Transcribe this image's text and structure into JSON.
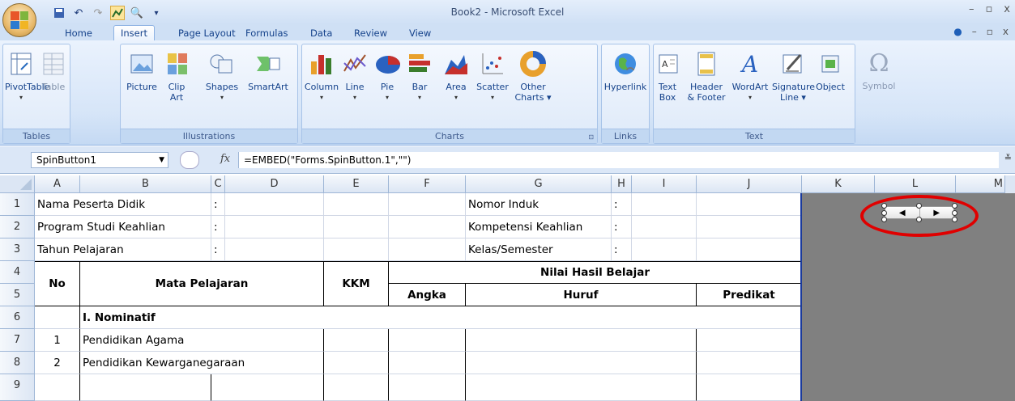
{
  "window": {
    "title": "Book2 - Microsoft Excel"
  },
  "qat": {
    "save_icon": "save-icon",
    "undo_icon": "undo-icon",
    "redo_icon": "redo-icon",
    "chart_icon": "chart-icon",
    "customize_icon": "customize-icon"
  },
  "tabs": [
    "Home",
    "Insert",
    "Page Layout",
    "Formulas",
    "Data",
    "Review",
    "View"
  ],
  "active_tab": "Insert",
  "ribbon": {
    "groups": {
      "tables": "Tables",
      "illustrations": "Illustrations",
      "charts": "Charts",
      "links": "Links",
      "text": "Text"
    },
    "buttons": {
      "pivottable": "PivotTable",
      "table": "Table",
      "picture": "Picture",
      "clipart_1": "Clip",
      "clipart_2": "Art",
      "shapes": "Shapes",
      "smartart": "SmartArt",
      "column": "Column",
      "line": "Line",
      "pie": "Pie",
      "bar": "Bar",
      "area": "Area",
      "scatter": "Scatter",
      "other_1": "Other",
      "other_2": "Charts ▾",
      "hyperlink": "Hyperlink",
      "textbox_1": "Text",
      "textbox_2": "Box",
      "header_1": "Header",
      "header_2": "& Footer",
      "wordart": "WordArt",
      "signature_1": "Signature",
      "signature_2": "Line ▾",
      "object": "Object",
      "symbol": "Symbol"
    }
  },
  "formula_bar": {
    "name_box": "SpinButton1",
    "fx": "fx",
    "formula": "=EMBED(\"Forms.SpinButton.1\",\"\")"
  },
  "columns": [
    "A",
    "B",
    "C",
    "D",
    "E",
    "F",
    "G",
    "H",
    "I",
    "J",
    "K",
    "L",
    "M"
  ],
  "rows": [
    "1",
    "2",
    "3",
    "4",
    "5",
    "6",
    "7",
    "8",
    "9"
  ],
  "cells": {
    "a1": "Nama Peserta Didik",
    "c1": ":",
    "g1": "Nomor Induk",
    "h1": ":",
    "a2": "Program Studi Keahlian",
    "c2": ":",
    "g2": "Kompetensi Keahlian",
    "h2": ":",
    "a3": "Tahun Pelajaran",
    "c3": ":",
    "g3": "Kelas/Semester",
    "h3": ":",
    "no": "No",
    "mapel": "Mata Pelajaran",
    "kkm": "KKM",
    "nilai": "Nilai Hasil Belajar",
    "angka": "Angka",
    "huruf": "Huruf",
    "predikat": "Predikat",
    "b6": "I. Nominatif",
    "a7": "1",
    "b7": "Pendidikan Agama",
    "a8": "2",
    "b8": "Pendidikan Kewarganegaraan"
  },
  "spin_button": {
    "left_arrow": "◀",
    "right_arrow": "▶"
  },
  "colors": {
    "highlight_circle": "#e00000",
    "table_border": "#1a3a9c"
  }
}
